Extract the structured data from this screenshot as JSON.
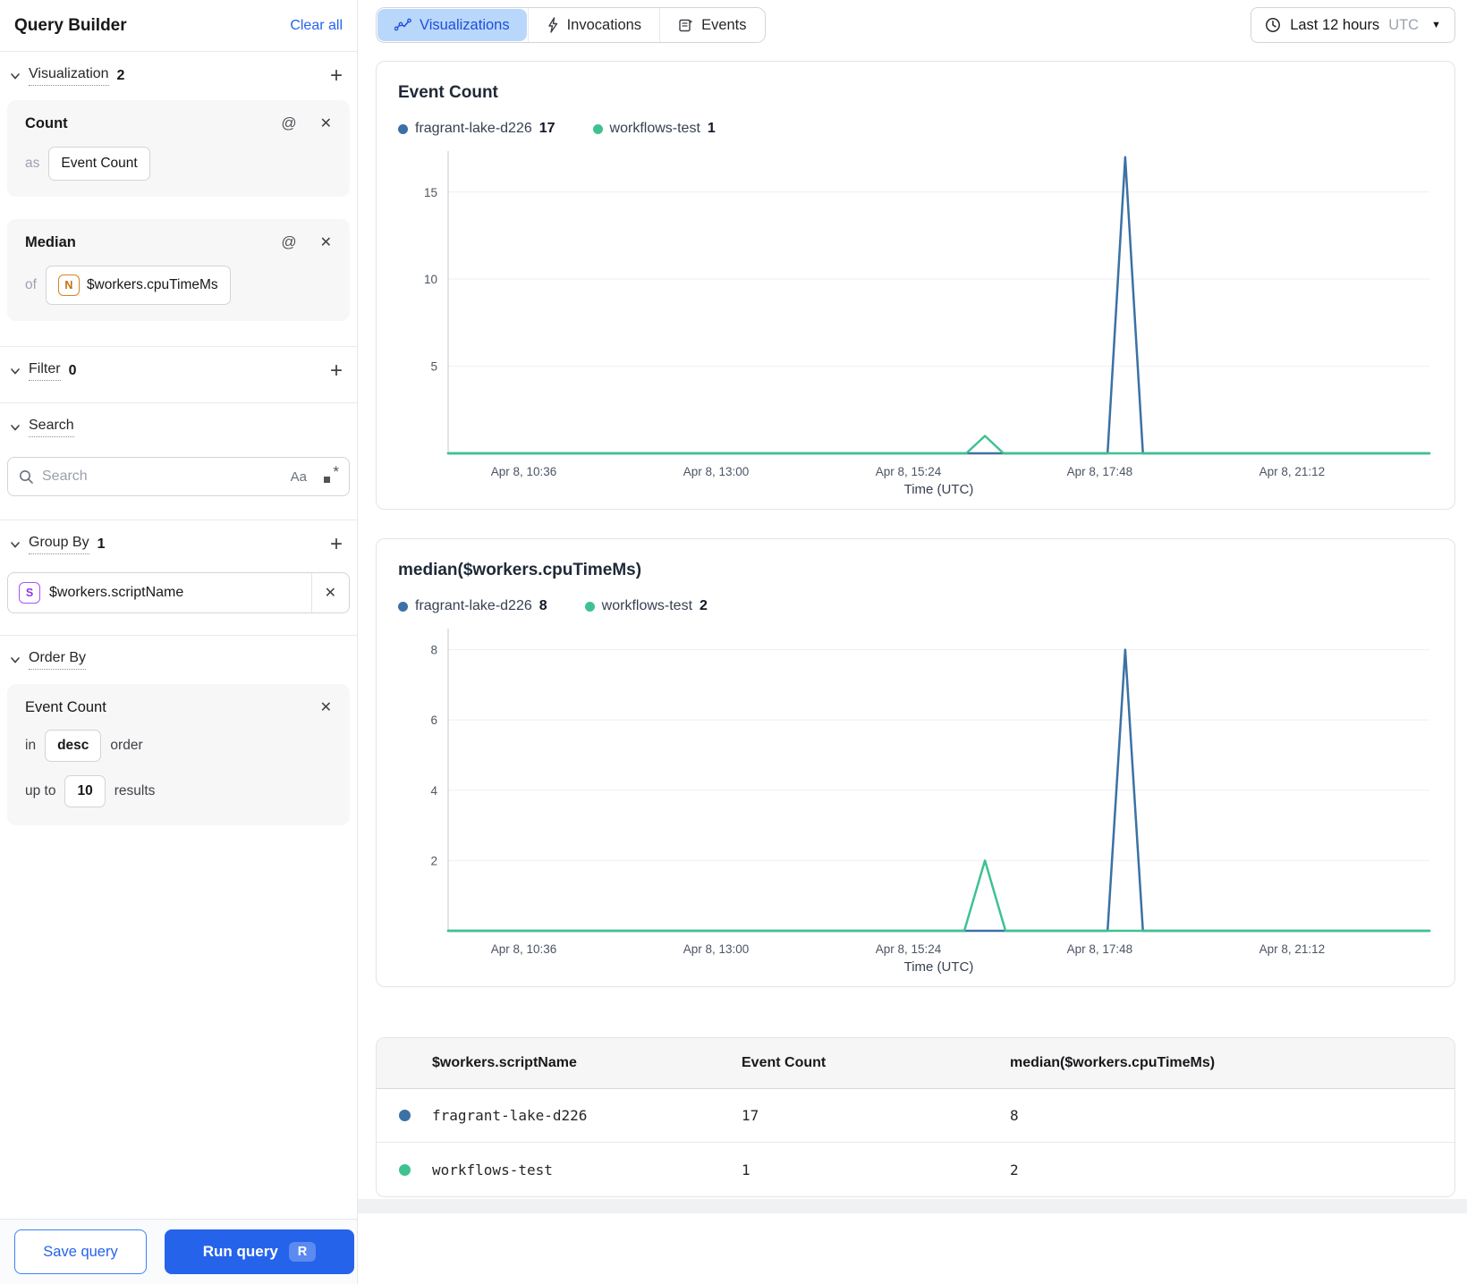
{
  "colors": {
    "accent_blue": "#2563eb",
    "series_blue": "#3b71a5",
    "series_green": "#3ec290",
    "tab_active_bg": "#b9d7fb"
  },
  "sidebar": {
    "title": "Query Builder",
    "clear_all": "Clear all",
    "visualization": {
      "label": "Visualization",
      "count": "2"
    },
    "count_card": {
      "title": "Count",
      "as_label": "as",
      "value": "Event Count"
    },
    "median_card": {
      "title": "Median",
      "of_label": "of",
      "chip": "N",
      "field": "$workers.cpuTimeMs"
    },
    "filter": {
      "label": "Filter",
      "count": "0"
    },
    "search": {
      "label": "Search",
      "placeholder": "Search",
      "case_icon": "Aa"
    },
    "group_by": {
      "label": "Group By",
      "count": "1",
      "chip": "S",
      "field": "$workers.scriptName"
    },
    "order_by": {
      "label": "Order By",
      "card": {
        "title": "Event Count",
        "in_label": "in",
        "direction": "desc",
        "order_label": "order",
        "upto_label": "up to",
        "limit": "10",
        "results_label": "results"
      }
    },
    "actions": {
      "save": "Save query",
      "run": "Run query",
      "run_shortcut": "R"
    }
  },
  "header": {
    "tabs": [
      {
        "label": "Visualizations"
      },
      {
        "label": "Invocations"
      },
      {
        "label": "Events"
      }
    ],
    "time_range": {
      "label": "Last 12 hours",
      "timezone": "UTC"
    }
  },
  "chart_data": [
    {
      "type": "line",
      "title": "Event Count",
      "xlabel": "Time (UTC)",
      "ylim": [
        0,
        17.35
      ],
      "yticks": [
        5,
        10,
        15
      ],
      "x_ticks": [
        {
          "f": 0.077,
          "label": "Apr 8, 10:36"
        },
        {
          "f": 0.273,
          "label": "Apr 8, 13:00"
        },
        {
          "f": 0.469,
          "label": "Apr 8, 15:24"
        },
        {
          "f": 0.664,
          "label": "Apr 8, 17:48"
        },
        {
          "f": 0.86,
          "label": "Apr 8, 21:12"
        }
      ],
      "series": [
        {
          "name": "fragrant-lake-d226",
          "total": "17",
          "color": "#3b71a5",
          "points": [
            [
              0,
              0
            ],
            [
              0.672,
              0
            ],
            [
              0.69,
              17
            ],
            [
              0.708,
              0
            ],
            [
              1,
              0
            ]
          ]
        },
        {
          "name": "workflows-test",
          "total": "1",
          "color": "#3ec290",
          "points": [
            [
              0,
              0
            ],
            [
              0.528,
              0
            ],
            [
              0.547,
              1
            ],
            [
              0.566,
              0
            ],
            [
              1,
              0
            ]
          ]
        }
      ]
    },
    {
      "type": "line",
      "title": "median($workers.cpuTimeMs)",
      "xlabel": "Time (UTC)",
      "ylim": [
        0,
        8.6
      ],
      "yticks": [
        2,
        4,
        6,
        8
      ],
      "x_ticks": [
        {
          "f": 0.077,
          "label": "Apr 8, 10:36"
        },
        {
          "f": 0.273,
          "label": "Apr 8, 13:00"
        },
        {
          "f": 0.469,
          "label": "Apr 8, 15:24"
        },
        {
          "f": 0.664,
          "label": "Apr 8, 17:48"
        },
        {
          "f": 0.86,
          "label": "Apr 8, 21:12"
        }
      ],
      "series": [
        {
          "name": "fragrant-lake-d226",
          "total": "8",
          "color": "#3b71a5",
          "points": [
            [
              0,
              0
            ],
            [
              0.672,
              0
            ],
            [
              0.69,
              8
            ],
            [
              0.708,
              0
            ],
            [
              1,
              0
            ]
          ]
        },
        {
          "name": "workflows-test",
          "total": "2",
          "color": "#3ec290",
          "points": [
            [
              0,
              0
            ],
            [
              0.526,
              0
            ],
            [
              0.547,
              2
            ],
            [
              0.568,
              0
            ],
            [
              1,
              0
            ]
          ]
        }
      ]
    }
  ],
  "table": {
    "columns": [
      "$workers.scriptName",
      "Event Count",
      "median($workers.cpuTimeMs)"
    ],
    "rows": [
      {
        "color": "#3b71a5",
        "name": "fragrant-lake-d226",
        "event_count": "17",
        "median": "8"
      },
      {
        "color": "#3ec290",
        "name": "workflows-test",
        "event_count": "1",
        "median": "2"
      }
    ]
  }
}
